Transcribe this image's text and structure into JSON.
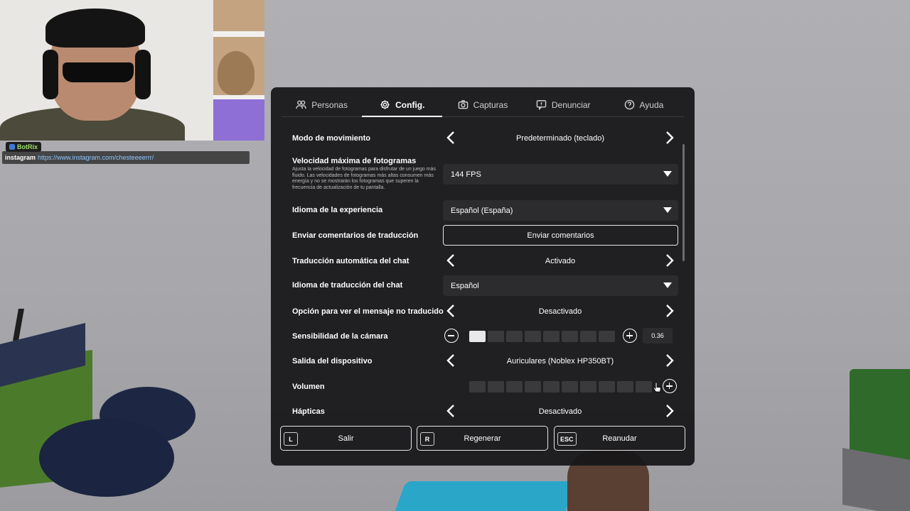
{
  "stream_overlay": {
    "bot_name": "BotRix",
    "chat_user": "instagram",
    "chat_message": "https://www.instagram.com/chesteeeerrr/"
  },
  "tabs": [
    {
      "label": "Personas",
      "icon": "people-icon",
      "active": false
    },
    {
      "label": "Config.",
      "icon": "gear-icon",
      "active": true
    },
    {
      "label": "Capturas",
      "icon": "camera-icon",
      "active": false
    },
    {
      "label": "Denunciar",
      "icon": "report-flag-icon",
      "active": false
    },
    {
      "label": "Ayuda",
      "icon": "help-icon",
      "active": false
    }
  ],
  "settings": {
    "movement_mode": {
      "label": "Modo de movimiento",
      "value": "Predeterminado (teclado)"
    },
    "max_fps": {
      "label": "Velocidad máxima de fotogramas",
      "description": "Ajusta la velocidad de fotogramas para disfrutar de un juego más fluido. Las velocidades de fotogramas más altas consumen más energía y no se mostrarán los fotogramas que superen la frecuencia de actualización de tu pantalla.",
      "value": "144 FPS"
    },
    "experience_language": {
      "label": "Idioma de la experiencia",
      "value": "Español (España)"
    },
    "translation_feedback": {
      "label": "Enviar comentarios de traducción",
      "button": "Enviar comentarios"
    },
    "chat_auto_translate": {
      "label": "Traducción automática del chat",
      "value": "Activado"
    },
    "chat_translation_language": {
      "label": "Idioma de traducción del chat",
      "value": "Español"
    },
    "show_untranslated": {
      "label": "Opción para ver el mensaje no traducido",
      "value": "Desactivado"
    },
    "camera_sensitivity": {
      "label": "Sensibilidad de la cámara",
      "value": "0.36",
      "level": 0.1
    },
    "device_output": {
      "label": "Salida del dispositivo",
      "value": "Auriculares (Noblex HP350BT)"
    },
    "volume": {
      "label": "Volumen",
      "level": 0.0
    },
    "haptics": {
      "label": "Hápticas",
      "value": "Desactivado"
    }
  },
  "actions": [
    {
      "key": "L",
      "label": "Salir"
    },
    {
      "key": "R",
      "label": "Regenerar"
    },
    {
      "key": "ESC",
      "label": "Reanudar"
    }
  ],
  "colors": {
    "panel_bg": "#161618",
    "accent": "#ffffff",
    "slider_fill": "#e8e8ea",
    "slider_empty": "#3a3a3d"
  }
}
